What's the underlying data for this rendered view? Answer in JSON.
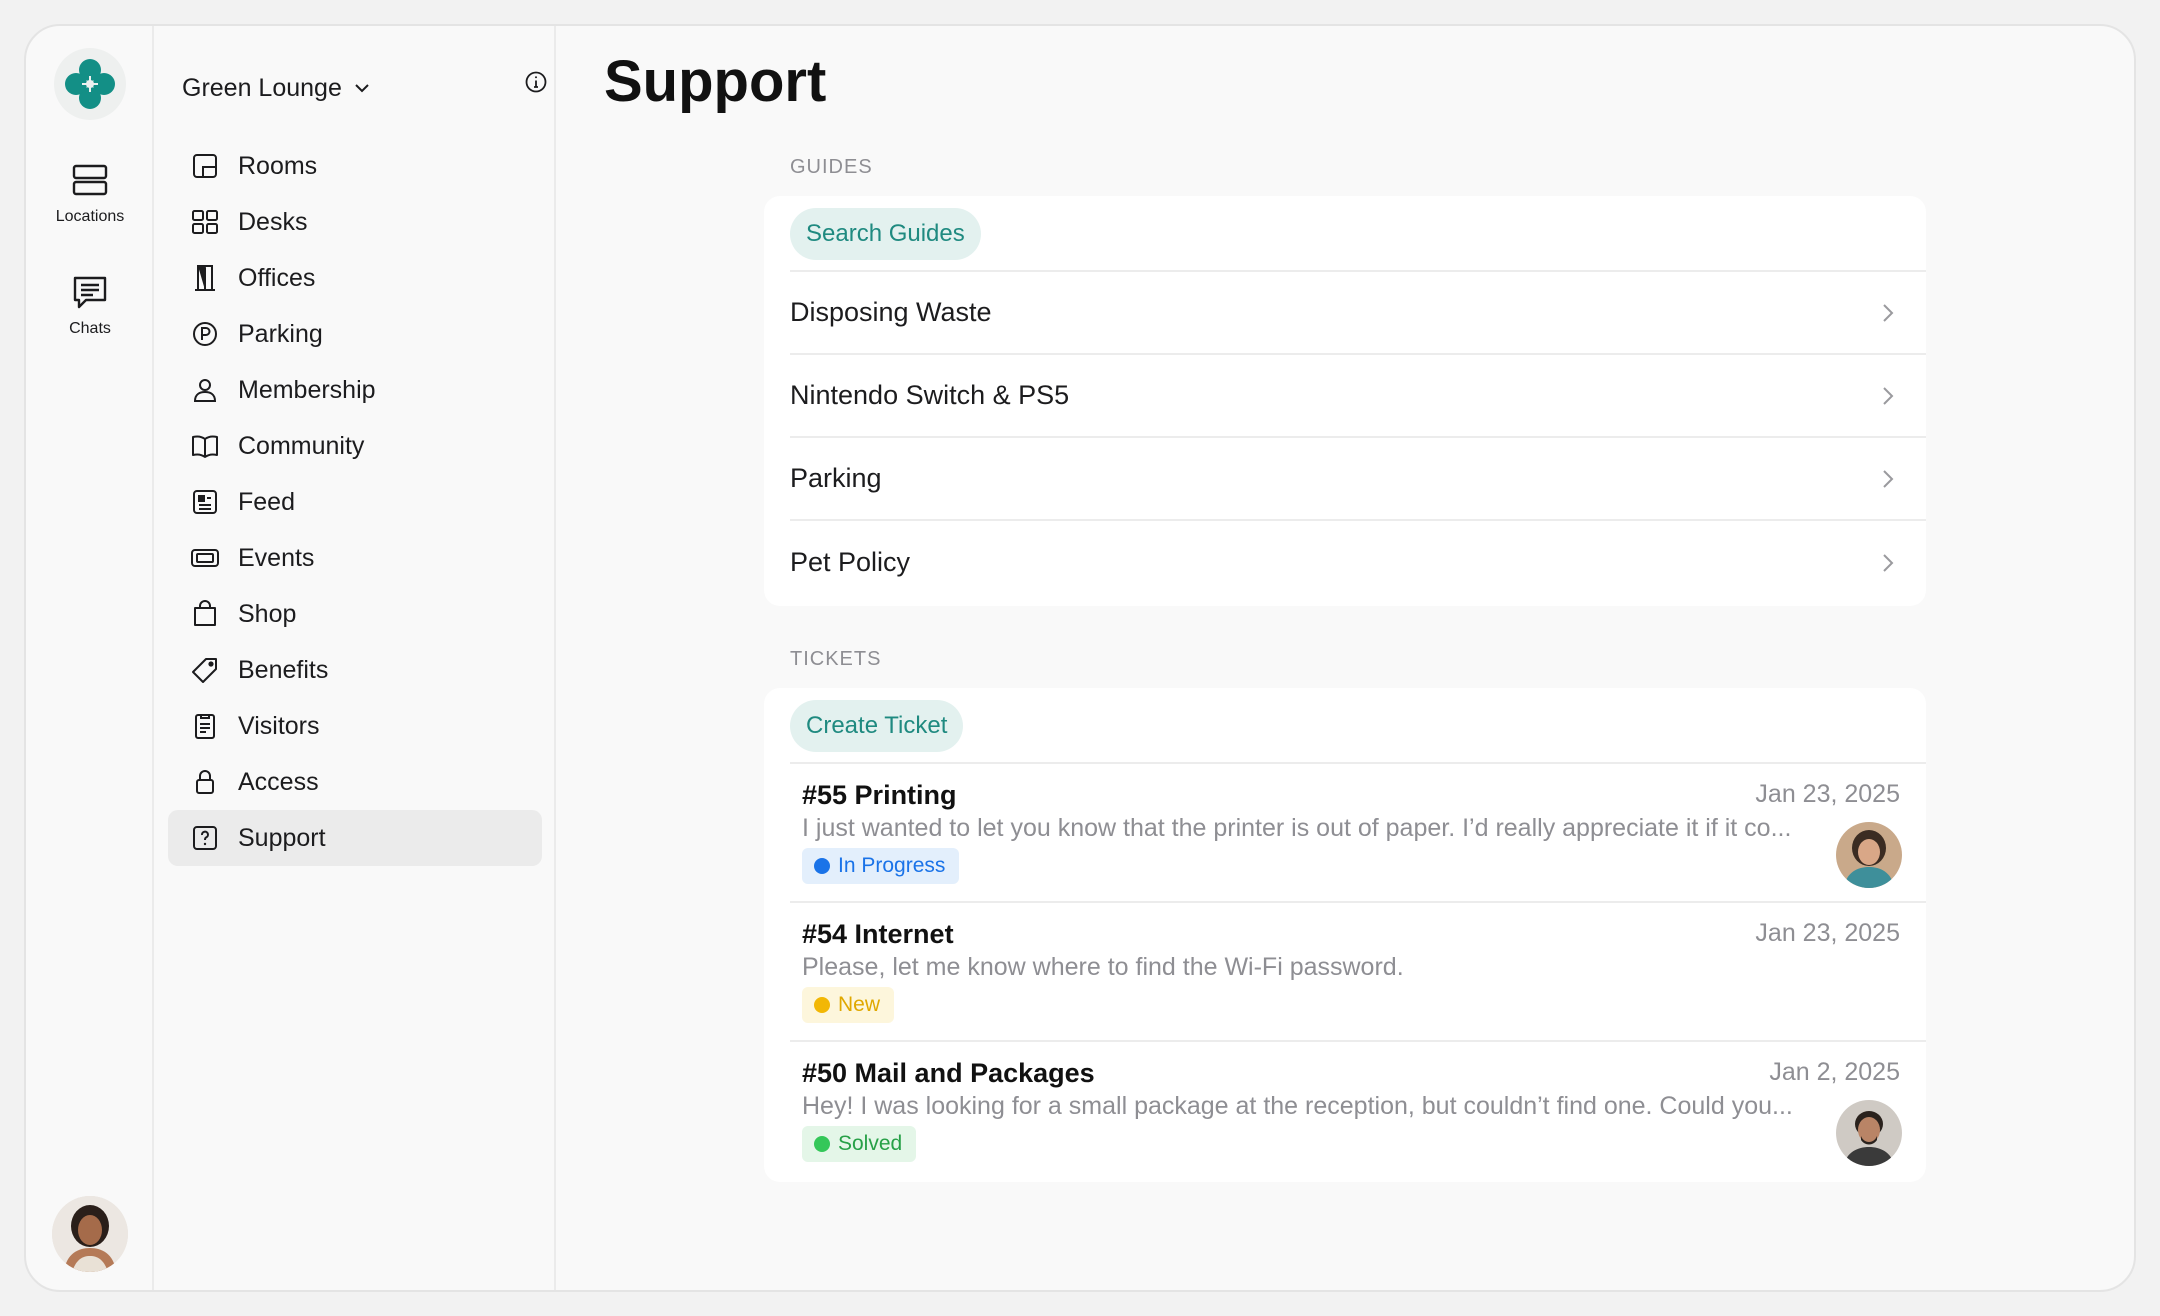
{
  "colors": {
    "accent": "#1f8a80",
    "status_in_progress": "#1a73e8",
    "status_new": "#f2b705",
    "status_solved": "#34c759"
  },
  "rail": {
    "logo_icon": "flower-logo-icon",
    "items": [
      {
        "label": "Locations",
        "icon": "locations-icon"
      },
      {
        "label": "Chats",
        "icon": "chat-icon"
      }
    ]
  },
  "sidebar": {
    "org_name": "Green Lounge",
    "items": [
      {
        "label": "Rooms",
        "icon": "rooms-icon"
      },
      {
        "label": "Desks",
        "icon": "desks-icon"
      },
      {
        "label": "Offices",
        "icon": "offices-icon"
      },
      {
        "label": "Parking",
        "icon": "parking-icon"
      },
      {
        "label": "Membership",
        "icon": "membership-icon"
      },
      {
        "label": "Community",
        "icon": "book-icon"
      },
      {
        "label": "Feed",
        "icon": "feed-icon"
      },
      {
        "label": "Events",
        "icon": "ticket-icon"
      },
      {
        "label": "Shop",
        "icon": "bag-icon"
      },
      {
        "label": "Benefits",
        "icon": "tag-icon"
      },
      {
        "label": "Visitors",
        "icon": "clipboard-icon"
      },
      {
        "label": "Access",
        "icon": "lock-icon"
      },
      {
        "label": "Support",
        "icon": "help-icon",
        "active": true
      }
    ]
  },
  "main": {
    "title": "Support",
    "guides": {
      "section_label": "GUIDES",
      "search_label": "Search Guides",
      "items": [
        "Disposing Waste",
        "Nintendo Switch & PS5",
        "Parking",
        "Pet Policy"
      ]
    },
    "tickets": {
      "section_label": "TICKETS",
      "create_label": "Create Ticket",
      "items": [
        {
          "title": "#55 Printing",
          "date": "Jan 23, 2025",
          "body": "I just wanted to let you know that the printer is out of paper. I’d really appreciate it if it co...",
          "status": "In Progress"
        },
        {
          "title": "#54 Internet",
          "date": "Jan 23, 2025",
          "body": "Please, let me know where to find the Wi-Fi password.",
          "status": "New"
        },
        {
          "title": "#50 Mail and Packages",
          "date": "Jan 2, 2025",
          "body": "Hey! I was looking for a small package at the reception, but couldn’t find one. Could you...",
          "status": "Solved"
        }
      ]
    }
  }
}
